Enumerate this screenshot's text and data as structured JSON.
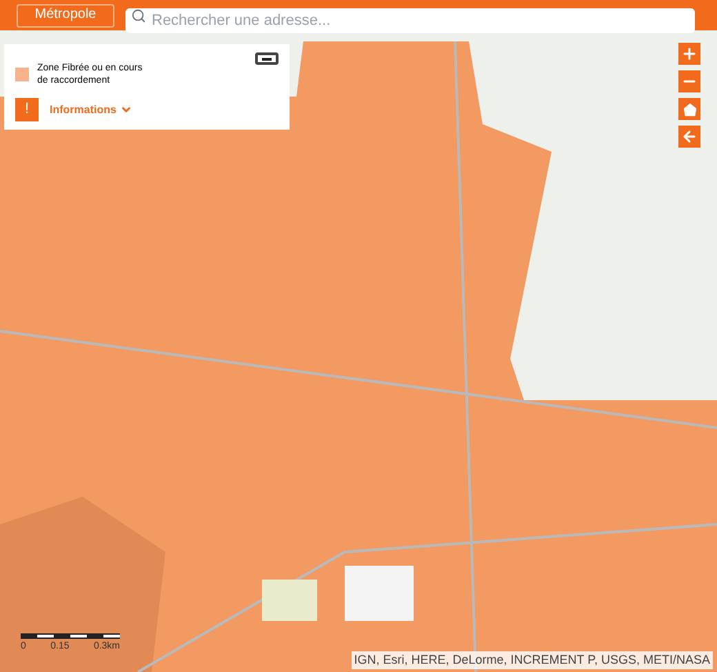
{
  "top_bar": {
    "button": "Métropole",
    "search": {
      "placeholder": "Rechercher une adresse..."
    }
  },
  "legend": {
    "expanded": true,
    "items": [
      {
        "label": "Zone Fibrée ou en cours de raccordement",
        "color": "#f5b48c"
      }
    ],
    "info": {
      "icon": "!",
      "label": "Informations",
      "expanded": false
    }
  },
  "scale": {
    "labels": [
      "0",
      "0.15",
      "0.3km"
    ]
  },
  "attribution": "IGN, Esri, HERE, DeLorme, INCREMENT P, USGS, METI/NASA"
}
